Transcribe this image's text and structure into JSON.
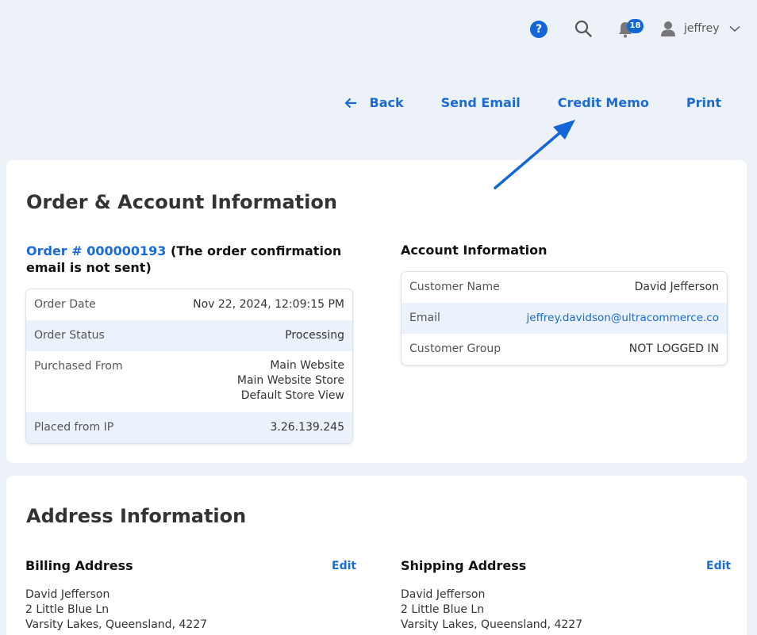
{
  "header": {
    "help_glyph": "?",
    "notification_count": "18",
    "username": "jeffrey"
  },
  "actions": {
    "back": "Back",
    "send_email": "Send Email",
    "credit_memo": "Credit Memo",
    "print": "Print"
  },
  "order_account": {
    "title": "Order & Account Information",
    "order_link": "Order # 000000193",
    "order_note": "(The order confirmation email is not sent)",
    "order_rows": [
      {
        "label": "Order Date",
        "value": "Nov 22, 2024, 12:09:15 PM"
      },
      {
        "label": "Order Status",
        "value": "Processing"
      },
      {
        "label": "Purchased From",
        "value_lines": [
          "Main Website",
          "Main Website Store",
          "Default Store View"
        ]
      },
      {
        "label": "Placed from IP",
        "value": "3.26.139.245"
      }
    ],
    "account_title": "Account Information",
    "account_rows": [
      {
        "label": "Customer Name",
        "value": "David Jefferson"
      },
      {
        "label": "Email",
        "value": "jeffrey.davidson@ultracommerce.co"
      },
      {
        "label": "Customer Group",
        "value": "NOT LOGGED IN"
      }
    ]
  },
  "address_info": {
    "title": "Address Information",
    "billing": {
      "title": "Billing Address",
      "edit_label": "Edit",
      "lines": [
        "David Jefferson",
        "2 Little Blue Ln",
        "Varsity Lakes, Queensland, 4227"
      ]
    },
    "shipping": {
      "title": "Shipping Address",
      "edit_label": "Edit",
      "lines": [
        "David Jefferson",
        "2 Little Blue Ln",
        "Varsity Lakes, Queensland, 4227"
      ]
    }
  },
  "colors": {
    "accent": "#1a6bd4",
    "background": "#edf2f9",
    "shaded_row": "#ebf2fb"
  }
}
